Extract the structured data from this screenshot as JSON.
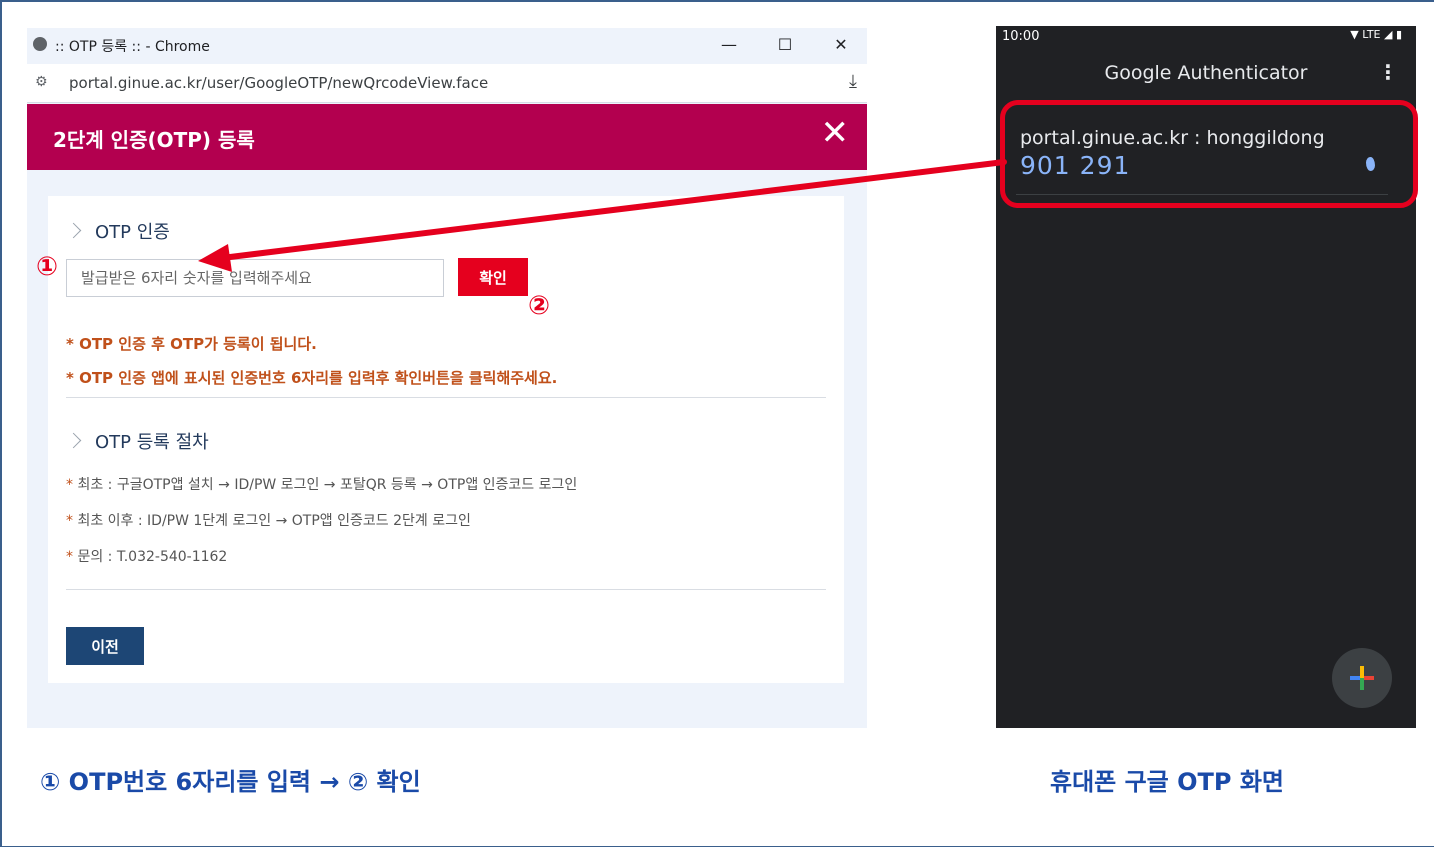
{
  "browser": {
    "window_title": ":: OTP 등록 :: - Chrome",
    "url": "portal.ginue.ac.kr/user/GoogleOTP/newQrcodeView.face",
    "controls": {
      "minimize": "—",
      "maximize": "☐",
      "close": "✕"
    }
  },
  "modal": {
    "title": "2단계 인증(OTP) 등록",
    "close": "✕",
    "otp_section": {
      "heading": "OTP 인증",
      "input_placeholder": "발급받은 6자리 숫자를 입력해주세요",
      "confirm_label": "확인",
      "notes": [
        "* OTP 인증 후 OTP가 등록이 됩니다.",
        "* OTP 인증 앱에 표시된 인증번호 6자리를 입력후 확인버튼을 클릭해주세요."
      ]
    },
    "procedure_section": {
      "heading": "OTP 등록 절차",
      "steps": [
        {
          "star": "*",
          "text": " 최초 : 구글OTP앱 설치 → ID/PW 로그인 → 포탈QR 등록 → OTP앱 인증코드 로그인"
        },
        {
          "star": "*",
          "text": " 최초 이후 : ID/PW 1단계 로그인 → OTP앱 인증코드 2단계 로그인"
        },
        {
          "star": "*",
          "text": " 문의 : T.032-540-1162"
        }
      ]
    },
    "prev_label": "이전"
  },
  "annotations": {
    "mark1": "①",
    "mark2": "②",
    "accent": "#e5001e"
  },
  "phone": {
    "time": "10:00",
    "status_icons": "▼ LTE ◢ ▮",
    "app_title": "Google Authenticator",
    "menu_icon": "⋮",
    "account": "portal.ginue.ac.kr : honggildong",
    "code": "901 291"
  },
  "captions": {
    "left": "① OTP번호 6자리를 입력 → ② 확인",
    "right": "휴대폰 구글 OTP 화면"
  }
}
